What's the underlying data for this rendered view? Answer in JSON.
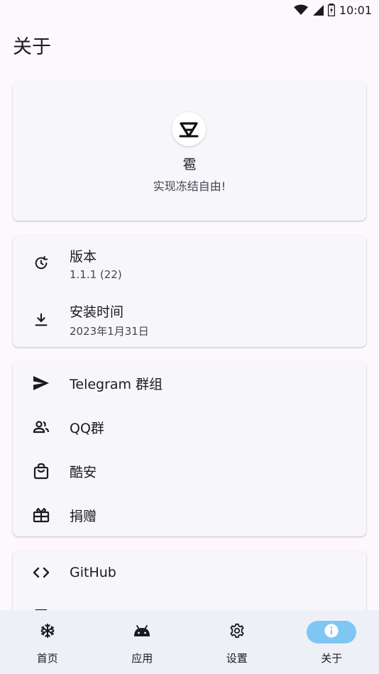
{
  "status_bar": {
    "time": "10:01",
    "icons": [
      "wifi-icon",
      "signal-icon",
      "battery-icon"
    ]
  },
  "page": {
    "title": "关于"
  },
  "app_card": {
    "logo_icon": "app-logo-icon",
    "name": "雹",
    "tagline": "实现冻结自由!"
  },
  "info_card": {
    "items": [
      {
        "icon": "update-icon",
        "label": "版本",
        "value": "1.1.1 (22)"
      },
      {
        "icon": "download-icon",
        "label": "安装时间",
        "value": "2023年1月31日"
      }
    ]
  },
  "links_card": {
    "items": [
      {
        "icon": "send-icon",
        "label": "Telegram 群组"
      },
      {
        "icon": "group-icon",
        "label": "QQ群"
      },
      {
        "icon": "shopping-bag-icon",
        "label": "酷安"
      },
      {
        "icon": "gift-icon",
        "label": "捐赠"
      }
    ]
  },
  "more_card": {
    "items": [
      {
        "icon": "code-icon",
        "label": "GitHub"
      },
      {
        "icon": "book-icon",
        "label": ""
      }
    ]
  },
  "bottom_nav": {
    "items": [
      {
        "icon": "snowflake-icon",
        "label": "首页",
        "active": false
      },
      {
        "icon": "android-icon",
        "label": "应用",
        "active": false
      },
      {
        "icon": "settings-gear-icon",
        "label": "设置",
        "active": false
      },
      {
        "icon": "info-icon",
        "label": "关于",
        "active": true
      }
    ]
  },
  "colors": {
    "background": "#fdf8fd",
    "card": "#f7f7fb",
    "nav_background": "#eef0f8",
    "active_indicator": "#7ec6f4"
  }
}
